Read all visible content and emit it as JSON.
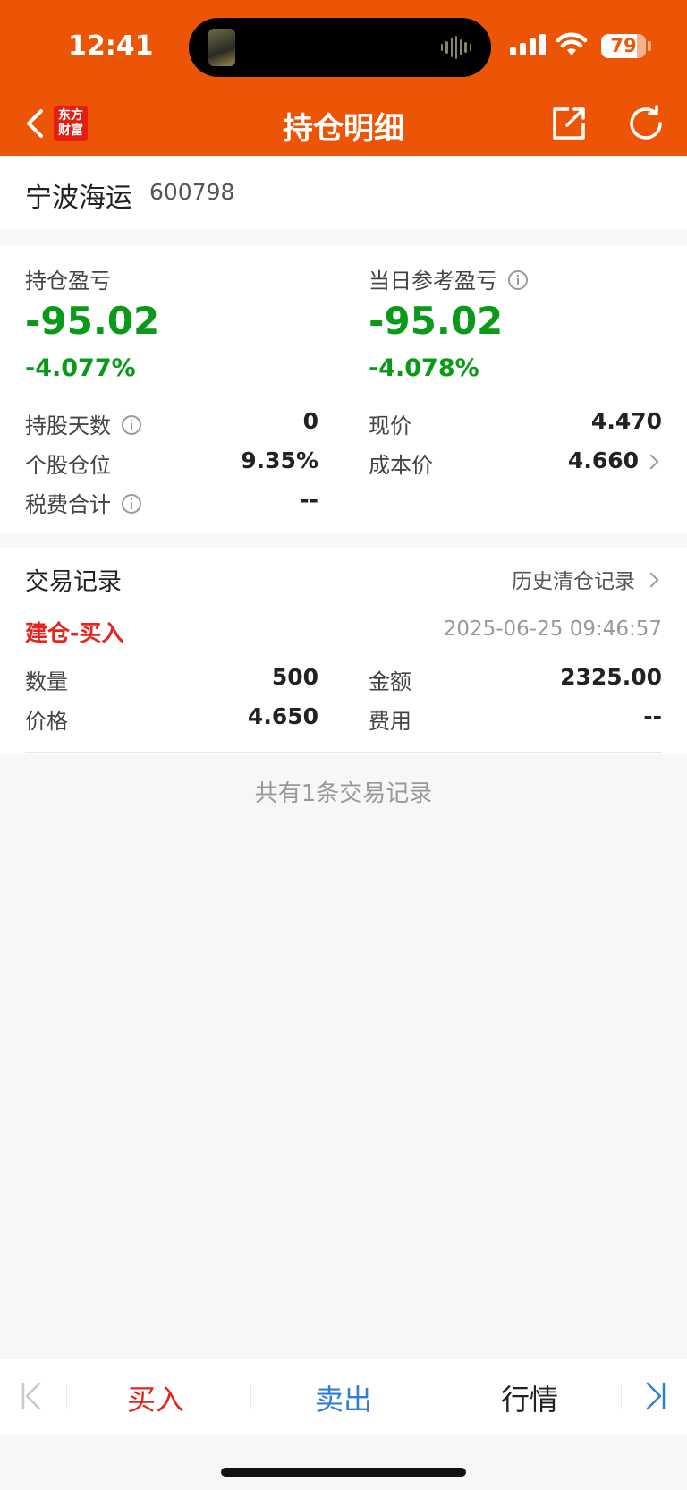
{
  "status": {
    "time": "12:41",
    "battery": "79",
    "battery_level": 0.79
  },
  "nav": {
    "title": "持仓明细",
    "logo_line1": "东方",
    "logo_line2": "财富"
  },
  "stock": {
    "name": "宁波海运",
    "code": "600798"
  },
  "pnl": {
    "hold_label": "持仓盈亏",
    "hold_value": "-95.02",
    "hold_pct": "-4.077%",
    "day_label": "当日参考盈亏",
    "day_value": "-95.02",
    "day_pct": "-4.078%"
  },
  "details": {
    "days_label": "持股天数",
    "days_value": "0",
    "position_label": "个股仓位",
    "position_value": "9.35%",
    "tax_label": "税费合计",
    "tax_value": "--",
    "price_label": "现价",
    "price_value": "4.470",
    "cost_label": "成本价",
    "cost_value": "4.660"
  },
  "trades": {
    "title": "交易记录",
    "history_link": "历史清仓记录",
    "record": {
      "type": "建仓-买入",
      "datetime": "2025-06-25 09:46:57",
      "qty_label": "数量",
      "qty_value": "500",
      "amount_label": "金额",
      "amount_value": "2325.00",
      "price_label": "价格",
      "price_value": "4.650",
      "fee_label": "费用",
      "fee_value": "--"
    },
    "count_text": "共有1条交易记录"
  },
  "bottom": {
    "buy": "买入",
    "sell": "卖出",
    "quote": "行情"
  },
  "colors": {
    "brand": "#eb5505",
    "loss_green": "#0a9a1a",
    "buy_red": "#e8231b",
    "sell_blue": "#2f7fd8"
  }
}
